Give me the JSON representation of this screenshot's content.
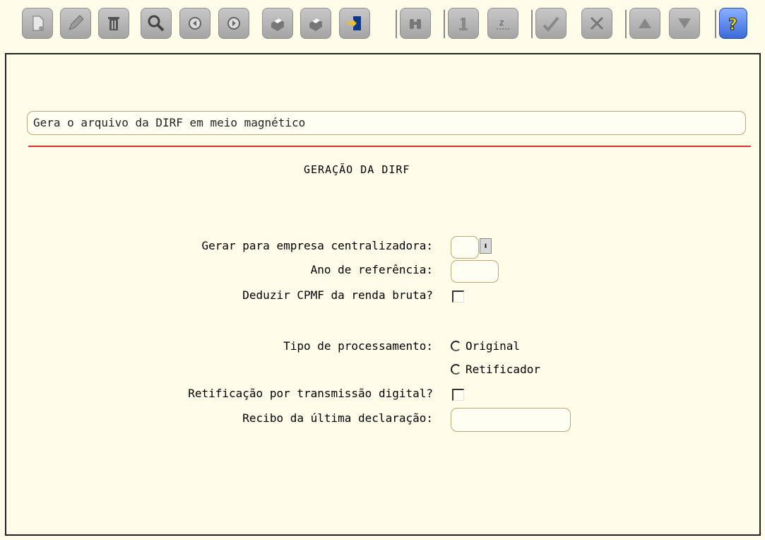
{
  "toolbar": {
    "buttons": [
      {
        "icon": "new-document-icon"
      },
      {
        "icon": "edit-pencil-icon"
      },
      {
        "icon": "delete-trash-icon"
      },
      {
        "icon": "search-icon"
      },
      {
        "icon": "previous-icon"
      },
      {
        "icon": "next-icon"
      },
      {
        "icon": "print-icon"
      },
      {
        "icon": "print-setup-icon"
      },
      {
        "icon": "exit-door-icon"
      },
      {
        "icon": "find-binoculars-icon"
      },
      {
        "icon": "first-record-icon"
      },
      {
        "icon": "last-record-icon"
      },
      {
        "icon": "confirm-check-icon"
      },
      {
        "icon": "cancel-tools-icon"
      },
      {
        "icon": "scroll-up-icon"
      },
      {
        "icon": "scroll-down-icon"
      },
      {
        "icon": "help-question-icon"
      }
    ]
  },
  "description": "Gera o arquivo da DIRF em meio magnético",
  "form": {
    "title": "GERAÇÃO DA DIRF",
    "empresa_label": "Gerar para empresa centralizadora:",
    "empresa_value": "",
    "ano_label": "Ano de referência:",
    "ano_value": "",
    "cpmf_label": "Deduzir CPMF da renda bruta?",
    "cpmf_checked": false,
    "tipo_label": "Tipo de processamento:",
    "tipo_options": [
      "Original",
      "Retificador"
    ],
    "tipo_selected": "",
    "retificacao_label": "Retificação por transmissão digital?",
    "retificacao_checked": false,
    "recibo_label": "Recibo da última declaração:",
    "recibo_value": ""
  },
  "colors": {
    "background": "#fffde9",
    "separator_line": "#d9322c",
    "field_border": "#b9ab70"
  }
}
